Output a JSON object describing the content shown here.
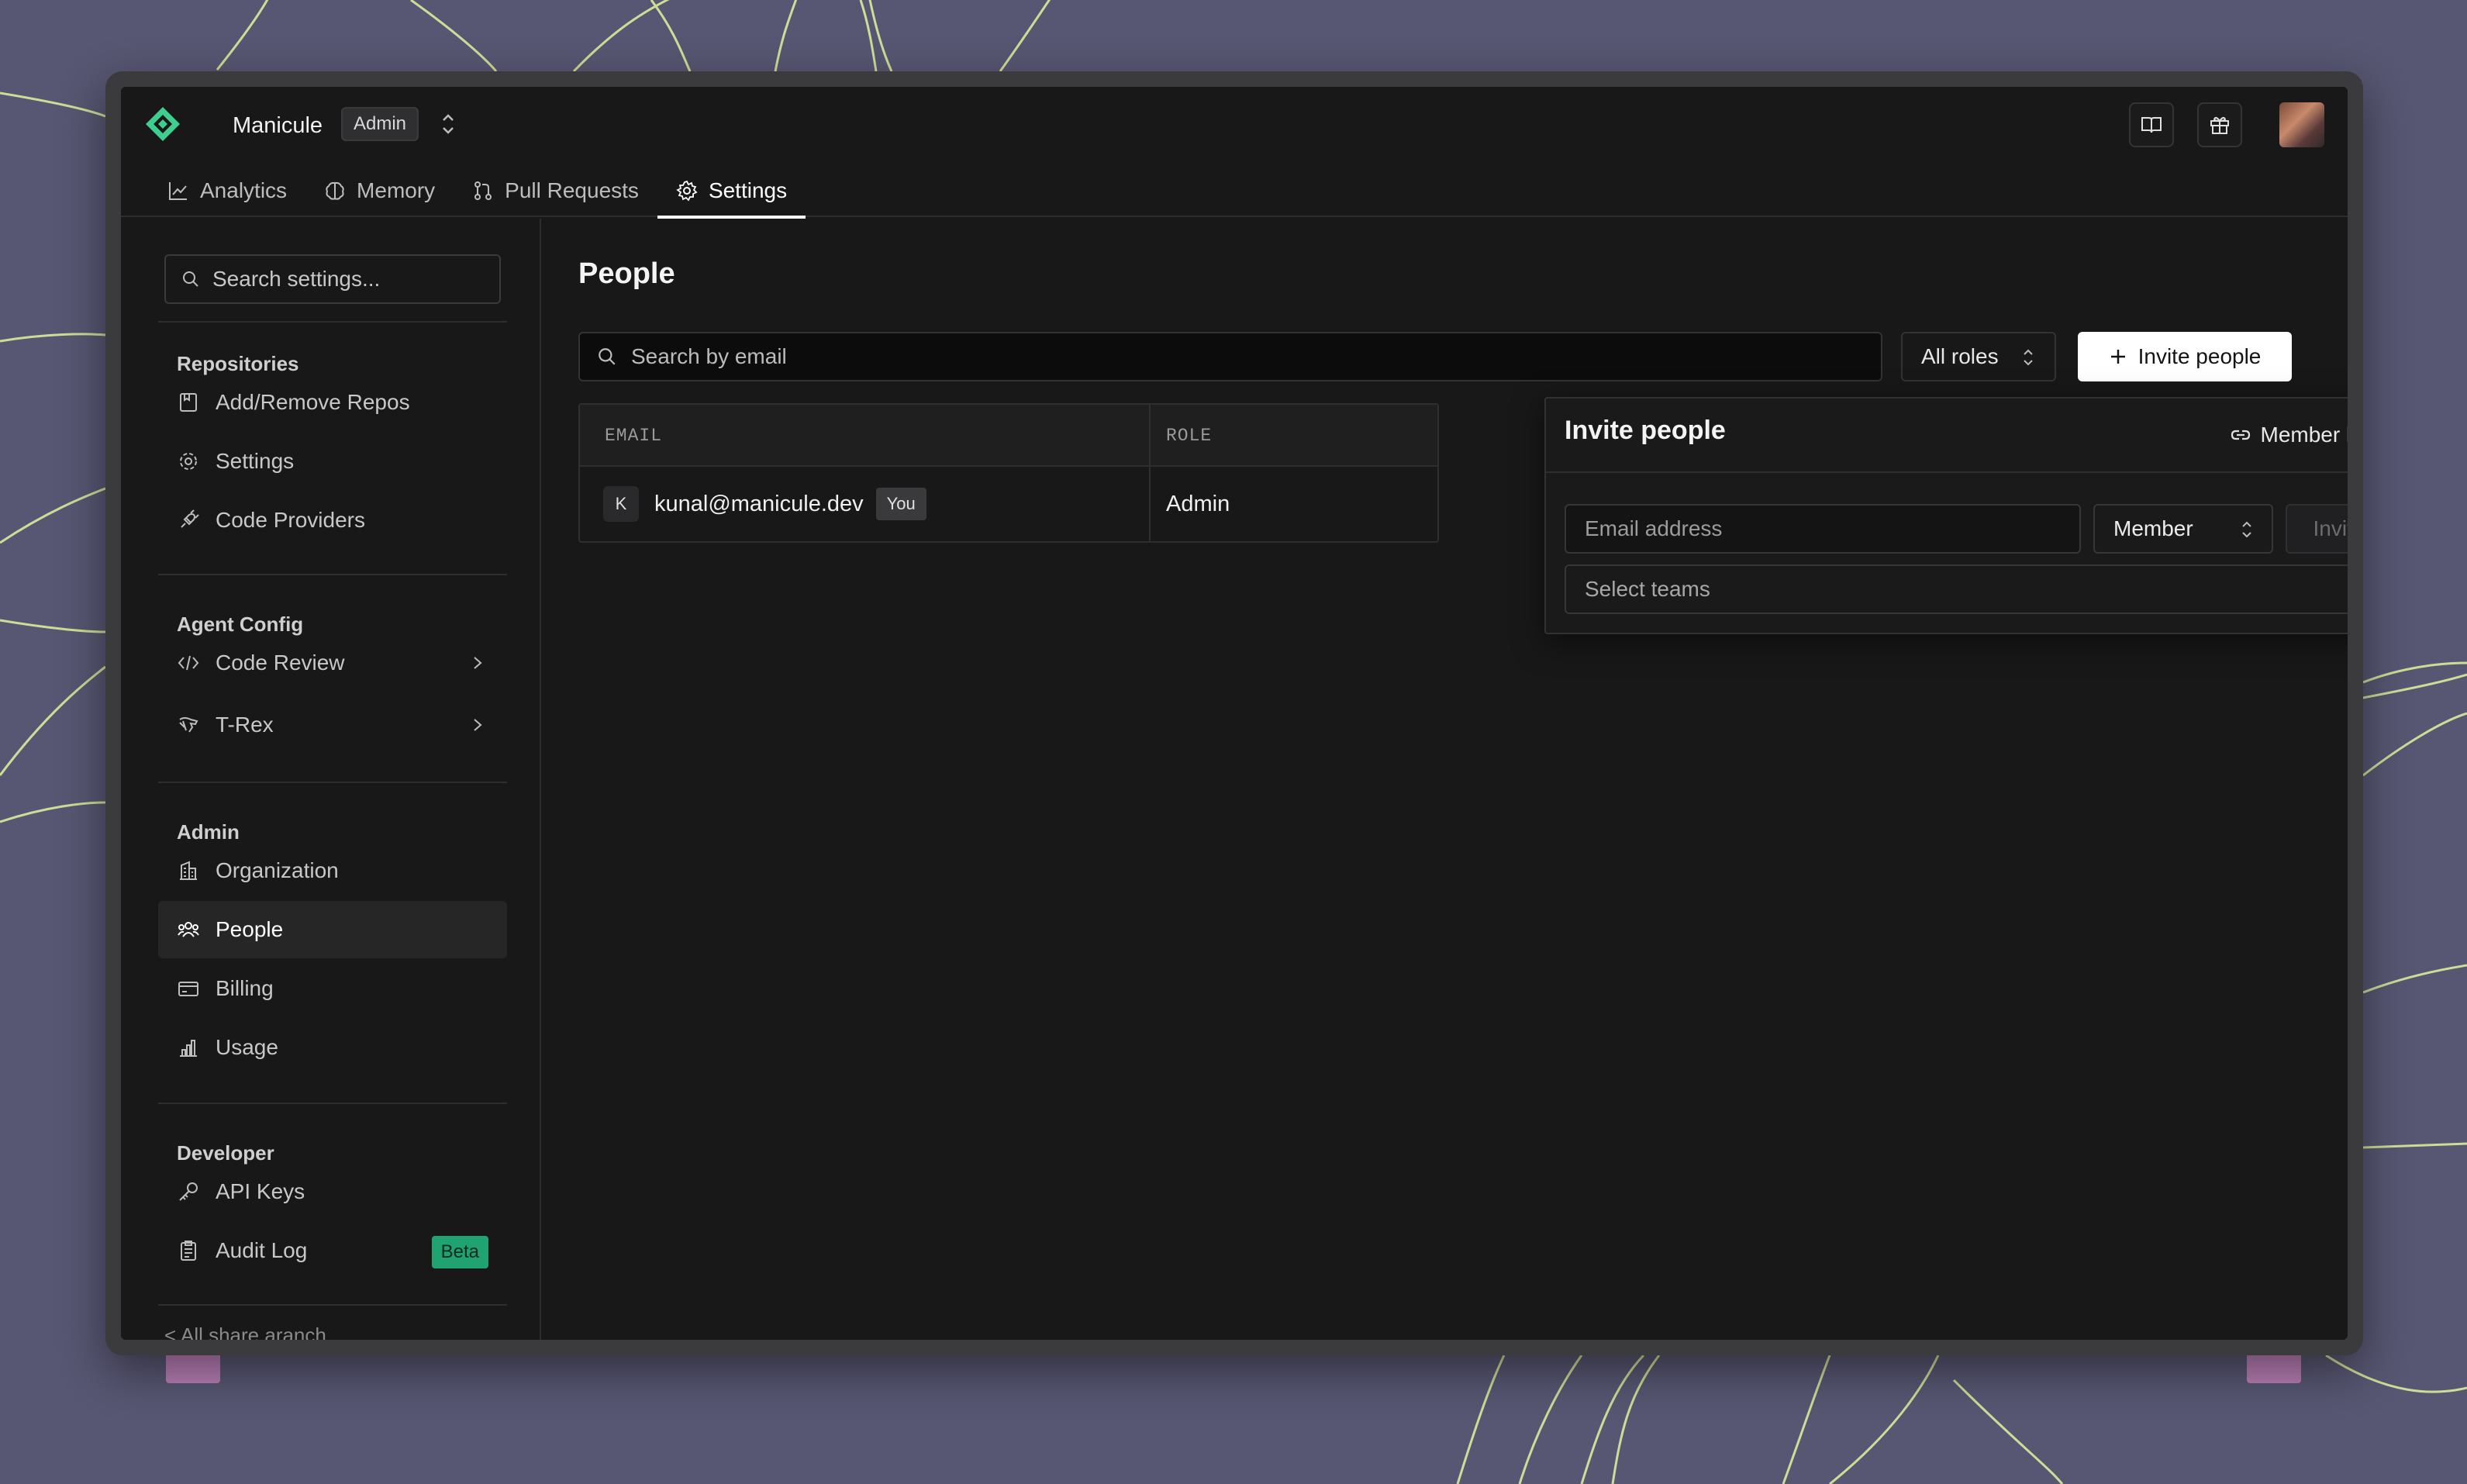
{
  "org": {
    "name": "Manicule",
    "role_badge": "Admin"
  },
  "tabs": [
    {
      "label": "Analytics",
      "icon": "chart-line-icon"
    },
    {
      "label": "Memory",
      "icon": "brain-icon"
    },
    {
      "label": "Pull Requests",
      "icon": "git-pull-request-icon"
    },
    {
      "label": "Settings",
      "icon": "gear-icon",
      "active": true
    }
  ],
  "sidebar": {
    "search_placeholder": "Search settings...",
    "sections": [
      {
        "heading": "Repositories",
        "items": [
          {
            "label": "Add/Remove Repos",
            "icon": "repo-icon"
          },
          {
            "label": "Settings",
            "icon": "gear-icon"
          },
          {
            "label": "Code Providers",
            "icon": "plug-icon"
          }
        ]
      },
      {
        "heading": "Agent Config",
        "items": [
          {
            "label": "Code Review",
            "icon": "code-icon"
          },
          {
            "label": "T-Rex",
            "icon": "dinosaur-icon"
          }
        ]
      },
      {
        "heading": "Admin",
        "items": [
          {
            "label": "Organization",
            "icon": "building-icon"
          },
          {
            "label": "People",
            "icon": "users-icon",
            "active": true
          },
          {
            "label": "Billing",
            "icon": "credit-card-icon"
          },
          {
            "label": "Usage",
            "icon": "bar-chart-icon"
          }
        ]
      },
      {
        "heading": "Developer",
        "items": [
          {
            "label": "API Keys",
            "icon": "key-icon"
          },
          {
            "label": "Audit Log",
            "icon": "clipboard-icon",
            "badge": "Beta"
          }
        ]
      }
    ],
    "footer_link": "< All share aranch"
  },
  "main": {
    "title": "People",
    "search_placeholder": "Search by email",
    "roles_filter": "All roles",
    "invite_button": "Invite people",
    "table": {
      "columns": [
        "EMAIL",
        "ROLE"
      ],
      "rows": [
        {
          "initial": "K",
          "email": "kunal@manicule.dev",
          "tag": "You",
          "role": "Admin"
        }
      ]
    }
  },
  "invite_popover": {
    "title": "Invite people",
    "member_link": "Member link",
    "email_placeholder": "Email address",
    "role": "Member",
    "invite_button": "Invite",
    "teams_placeholder": "Select teams"
  },
  "colors": {
    "accent": "#3ecf8e",
    "beta": "#20a271",
    "background": "#585773",
    "panel": "#181818"
  }
}
